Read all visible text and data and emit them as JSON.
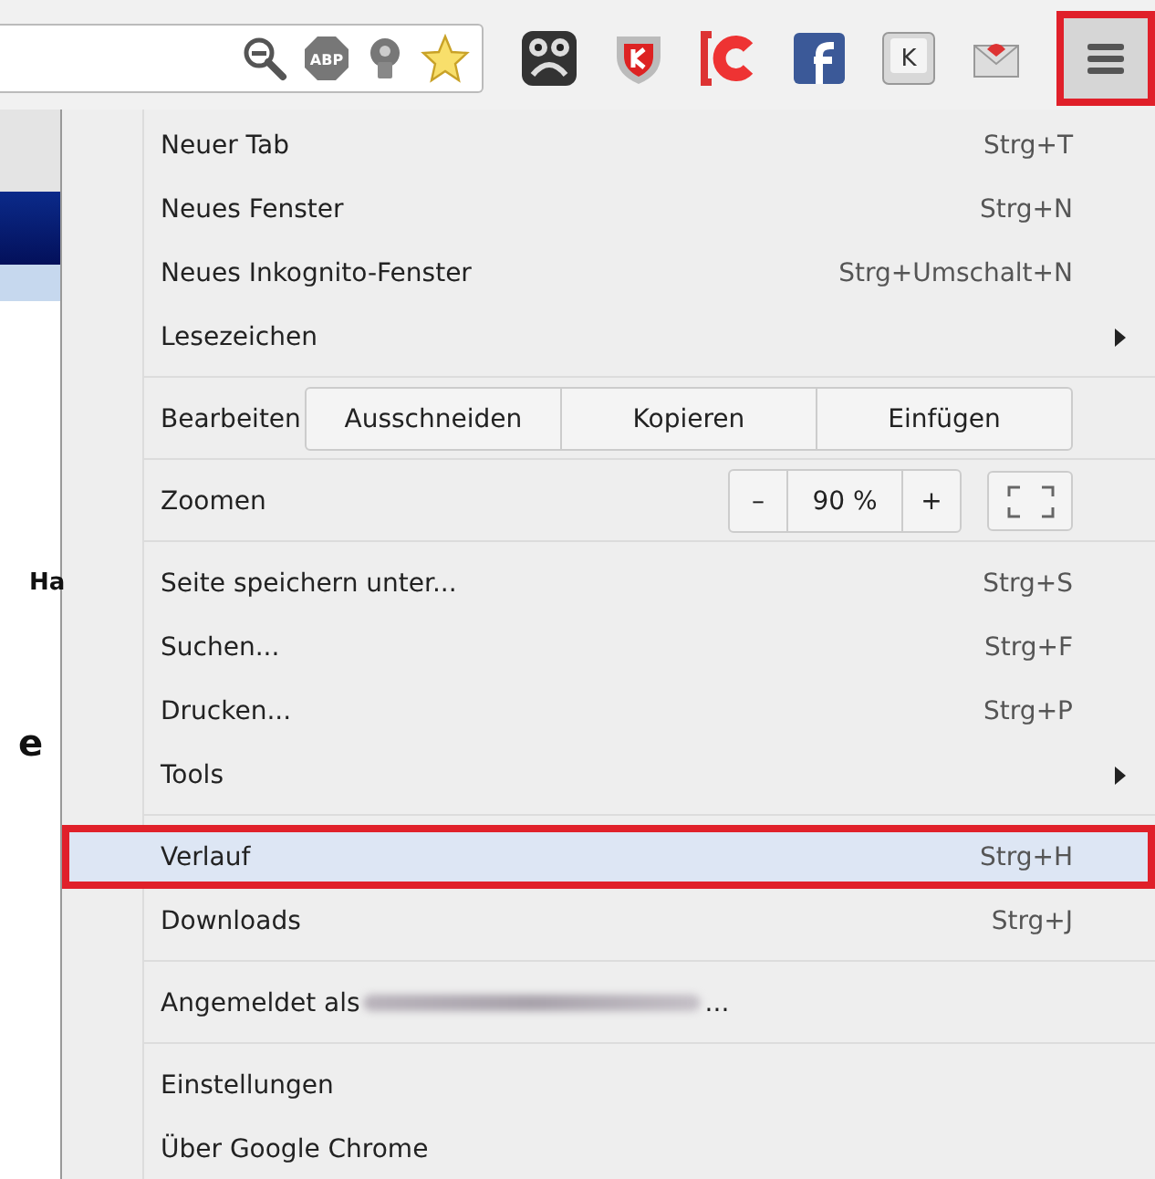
{
  "toolbar": {
    "abp_badge": "ABP",
    "key_badge": "K"
  },
  "menu_button": {
    "annotated": true
  },
  "page_fragments": [
    "Ha",
    "e"
  ],
  "menu": {
    "sections": [
      [
        {
          "kind": "item",
          "label": "Neuer Tab",
          "shortcut": "Strg+T",
          "selected": false,
          "annotated": false
        },
        {
          "kind": "item",
          "label": "Neues Fenster",
          "shortcut": "Strg+N",
          "selected": false,
          "annotated": false
        },
        {
          "kind": "item",
          "label": "Neues Inkognito-Fenster",
          "shortcut": "Strg+Umschalt+N",
          "selected": false,
          "annotated": false
        },
        {
          "kind": "submenu",
          "label": "Lesezeichen",
          "selected": false,
          "annotated": false
        }
      ],
      [
        {
          "kind": "edit",
          "label": "Bearbeiten",
          "buttons": [
            "Ausschneiden",
            "Kopieren",
            "Einfügen"
          ]
        }
      ],
      [
        {
          "kind": "zoom",
          "label": "Zoomen",
          "minus": "–",
          "value": "90 %",
          "plus": "+"
        }
      ],
      [
        {
          "kind": "item",
          "label": "Seite speichern unter...",
          "shortcut": "Strg+S",
          "selected": false,
          "annotated": false
        },
        {
          "kind": "item",
          "label": "Suchen...",
          "shortcut": "Strg+F",
          "selected": false,
          "annotated": false
        },
        {
          "kind": "item",
          "label": "Drucken...",
          "shortcut": "Strg+P",
          "selected": false,
          "annotated": false
        },
        {
          "kind": "submenu",
          "label": "Tools",
          "selected": false,
          "annotated": false
        }
      ],
      [
        {
          "kind": "item",
          "label": "Verlauf",
          "shortcut": "Strg+H",
          "selected": true,
          "annotated": true
        },
        {
          "kind": "item",
          "label": "Downloads",
          "shortcut": "Strg+J",
          "selected": false,
          "annotated": false
        }
      ],
      [
        {
          "kind": "signin",
          "label": "Angemeldet als",
          "suffix": "..."
        }
      ],
      [
        {
          "kind": "item",
          "label": "Einstellungen",
          "selected": false,
          "annotated": false
        },
        {
          "kind": "item",
          "label": "Über Google Chrome",
          "selected": false,
          "annotated": false
        }
      ]
    ]
  }
}
